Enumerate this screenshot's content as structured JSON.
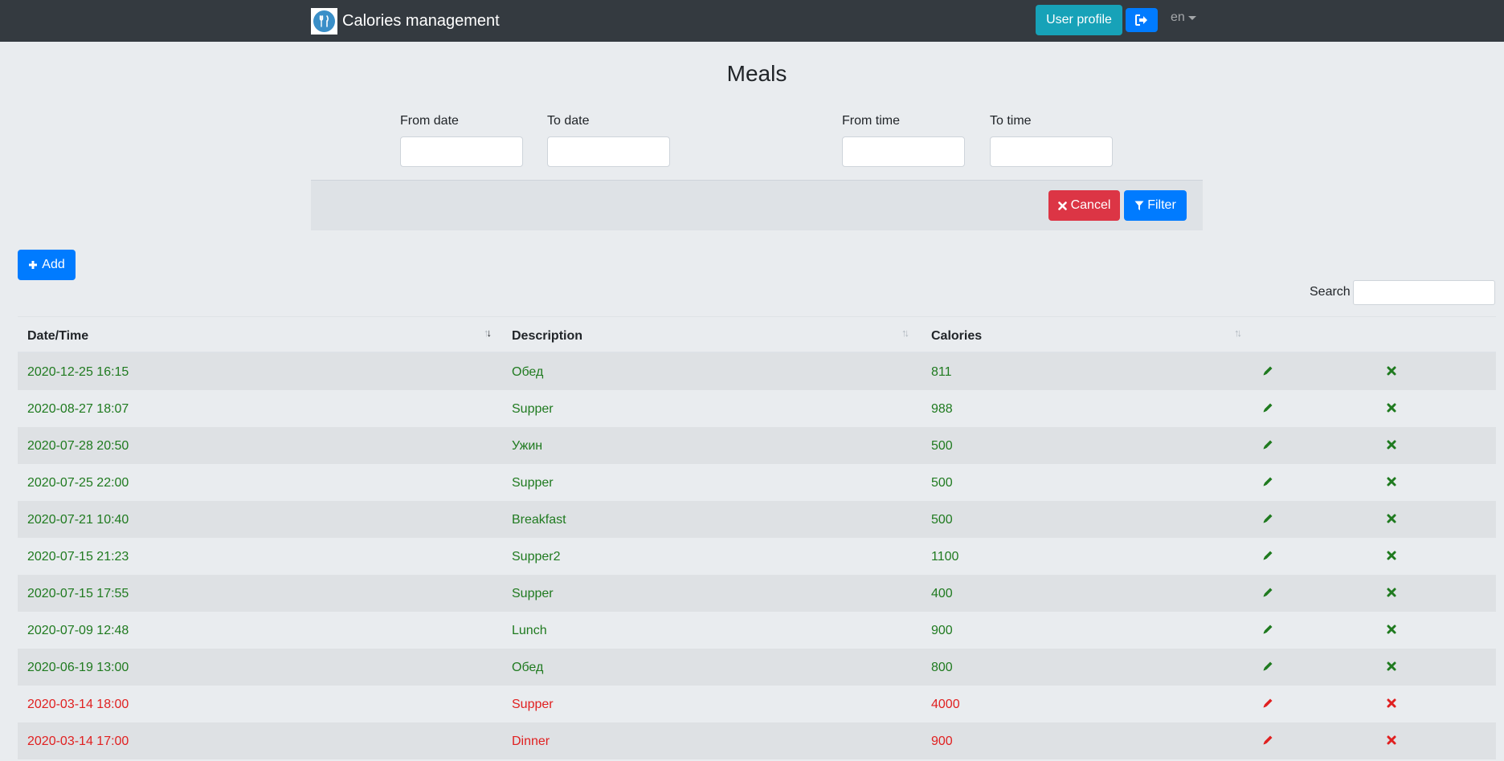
{
  "navbar": {
    "brand": "Calories management",
    "user_profile": "User profile",
    "lang": "en"
  },
  "page_title": "Meals",
  "filter": {
    "from_date": "From date",
    "to_date": "To date",
    "from_time": "From time",
    "to_time": "To time",
    "cancel": "Cancel",
    "filter": "Filter"
  },
  "add_label": "Add",
  "search_label": "Search",
  "table": {
    "headers": [
      "Date/Time",
      "Description",
      "Calories"
    ],
    "rows": [
      {
        "datetime": "2020-12-25 16:15",
        "description": "Обед",
        "calories": "811",
        "excess": false
      },
      {
        "datetime": "2020-08-27 18:07",
        "description": "Supper",
        "calories": "988",
        "excess": false
      },
      {
        "datetime": "2020-07-28 20:50",
        "description": "Ужин",
        "calories": "500",
        "excess": false
      },
      {
        "datetime": "2020-07-25 22:00",
        "description": "Supper",
        "calories": "500",
        "excess": false
      },
      {
        "datetime": "2020-07-21 10:40",
        "description": "Breakfast",
        "calories": "500",
        "excess": false
      },
      {
        "datetime": "2020-07-15 21:23",
        "description": "Supper2",
        "calories": "1100",
        "excess": false
      },
      {
        "datetime": "2020-07-15 17:55",
        "description": "Supper",
        "calories": "400",
        "excess": false
      },
      {
        "datetime": "2020-07-09 12:48",
        "description": "Lunch",
        "calories": "900",
        "excess": false
      },
      {
        "datetime": "2020-06-19 13:00",
        "description": "Обед",
        "calories": "800",
        "excess": false
      },
      {
        "datetime": "2020-03-14 18:00",
        "description": "Supper",
        "calories": "4000",
        "excess": true
      },
      {
        "datetime": "2020-03-14 17:00",
        "description": "Dinner",
        "calories": "900",
        "excess": true
      }
    ]
  },
  "colors": {
    "normal": "#1f7a1f",
    "excess": "#e02020",
    "primary": "#007bff",
    "danger": "#dc3545",
    "info": "#17a2b8",
    "navbar": "#343a40"
  },
  "icons": {
    "edit": "pencil-icon",
    "delete": "times-icon",
    "add": "plus-icon",
    "filter": "filter-icon",
    "logout": "sign-out-icon"
  }
}
